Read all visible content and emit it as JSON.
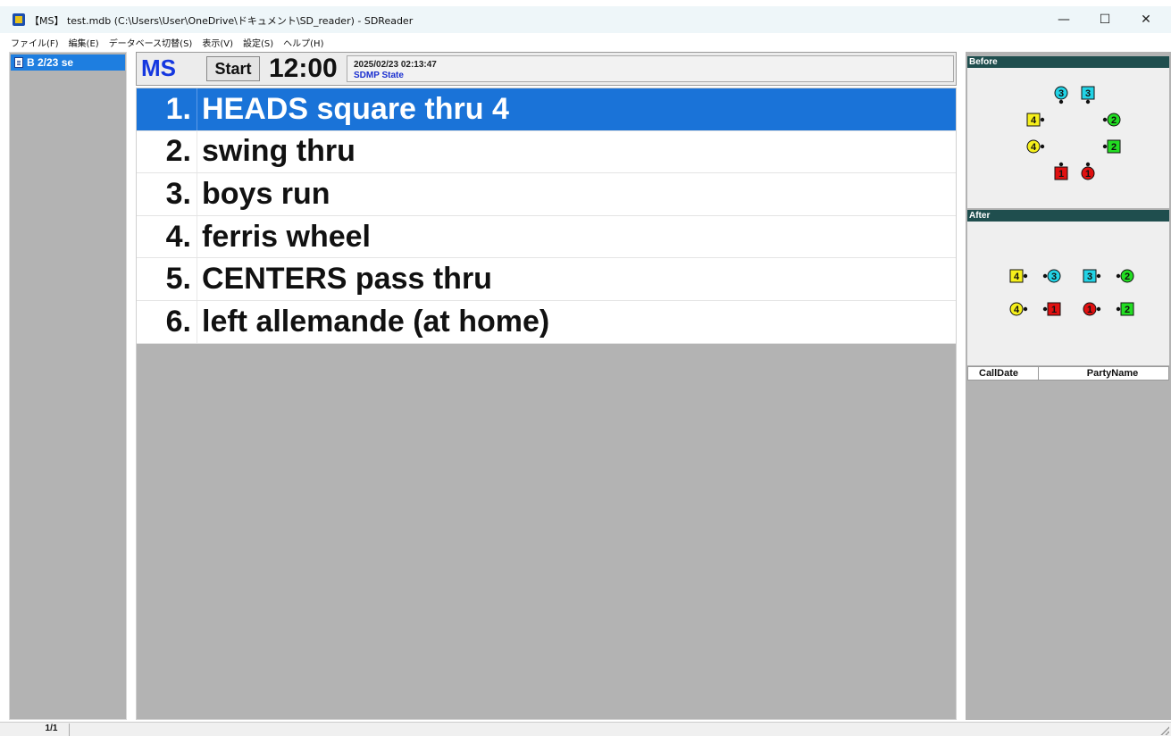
{
  "window": {
    "title": "【MS】 test.mdb (C:\\Users\\User\\OneDrive\\ドキュメント\\SD_reader) - SDReader",
    "min_glyph": "—",
    "max_glyph": "☐",
    "close_glyph": "✕"
  },
  "menu": [
    {
      "label": "ファイル(F)"
    },
    {
      "label": "編集(E)"
    },
    {
      "label": "データベース切替(S)"
    },
    {
      "label": "表示(V)"
    },
    {
      "label": "設定(S)"
    },
    {
      "label": "ヘルプ(H)"
    }
  ],
  "sidebar": {
    "items": [
      {
        "label": "B 2/23 se",
        "icon": "document-icon"
      }
    ]
  },
  "header": {
    "mode": "MS",
    "start_label": "Start",
    "clock": "12:00",
    "datetime": "2025/02/23 02:13:47",
    "state": "SDMP State"
  },
  "calls": [
    {
      "num": "1.",
      "text": "HEADS square thru 4",
      "selected": true
    },
    {
      "num": "2.",
      "text": "swing thru",
      "selected": false
    },
    {
      "num": "3.",
      "text": "boys run",
      "selected": false
    },
    {
      "num": "4.",
      "text": "ferris wheel",
      "selected": false
    },
    {
      "num": "5.",
      "text": "CENTERS pass thru",
      "selected": false
    },
    {
      "num": "6.",
      "text": "left allemande  (at home)",
      "selected": false
    }
  ],
  "right": {
    "before_label": "Before",
    "after_label": "After",
    "columns": {
      "call_date": "CallDate",
      "party_name": "PartyName"
    },
    "dancers": {
      "before": [
        {
          "shape": "circle",
          "num": "3",
          "color": "#22d3e6"
        },
        {
          "shape": "square",
          "num": "3",
          "color": "#22d3e6"
        },
        {
          "shape": "square",
          "num": "4",
          "color": "#f5ef1b"
        },
        {
          "shape": "circle",
          "num": "2",
          "color": "#22dd22"
        },
        {
          "shape": "circle",
          "num": "4",
          "color": "#f5ef1b"
        },
        {
          "shape": "square",
          "num": "2",
          "color": "#22dd22"
        },
        {
          "shape": "square",
          "num": "1",
          "color": "#e01010"
        },
        {
          "shape": "circle",
          "num": "1",
          "color": "#e01010"
        }
      ],
      "after": [
        {
          "shape": "square",
          "num": "4",
          "color": "#f5ef1b"
        },
        {
          "shape": "circle",
          "num": "3",
          "color": "#22d3e6"
        },
        {
          "shape": "square",
          "num": "3",
          "color": "#22d3e6"
        },
        {
          "shape": "circle",
          "num": "2",
          "color": "#22dd22"
        },
        {
          "shape": "circle",
          "num": "4",
          "color": "#f5ef1b"
        },
        {
          "shape": "square",
          "num": "1",
          "color": "#e01010"
        },
        {
          "shape": "circle",
          "num": "1",
          "color": "#e01010"
        },
        {
          "shape": "square",
          "num": "2",
          "color": "#22dd22"
        }
      ]
    }
  },
  "status": {
    "page": "1/1"
  },
  "colors": {
    "selection": "#1a73d8",
    "mode": "#1437e0",
    "panel_header": "#1f4e4e"
  }
}
